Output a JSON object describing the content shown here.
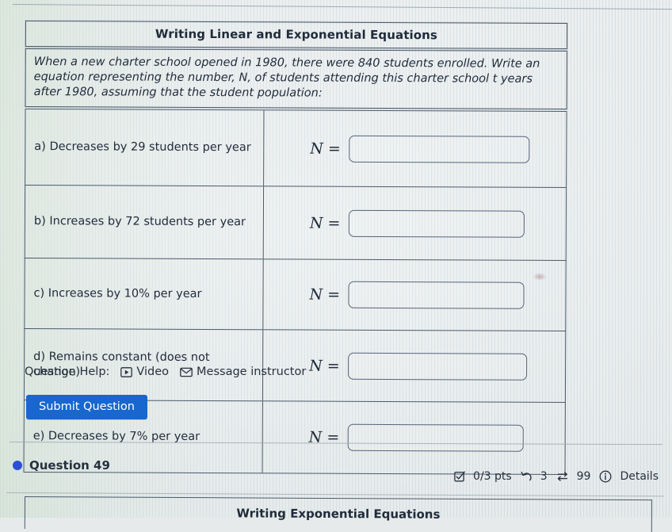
{
  "assignment": {
    "top_question": {
      "title": "Writing Linear and Exponential Equations",
      "prompt": "When a new charter school opened in 1980, there were 840 students enrolled. Write an equation representing the number, N, of students attending this charter school t years after 1980, assuming that the student population:",
      "rows": [
        {
          "label": "a) Decreases by 29 students per year",
          "lhs": "N =",
          "answer": ""
        },
        {
          "label": "b) Increases by 72 students per year",
          "lhs": "N =",
          "answer": ""
        },
        {
          "label": "c) Increases by 10% per year",
          "lhs": "N =",
          "answer": ""
        },
        {
          "label": "d) Remains constant (does not change)",
          "lhs": "N =",
          "answer": ""
        },
        {
          "label": "e) Decreases by 7% per year",
          "lhs": "N =",
          "answer": ""
        }
      ]
    },
    "help": {
      "label": "Question Help:",
      "video_label": "Video",
      "video_icon": "video-play-icon",
      "message_label": "Message instructor",
      "message_icon": "envelope-icon"
    },
    "submit_label": "Submit Question",
    "status": {
      "question_label": "Question 49",
      "points": "0/3 pts",
      "points_icon": "checkbox-check-icon",
      "attempts": "3",
      "attempts_icon": "undo-arrow-icon",
      "exchanges": "99",
      "exchanges_icon": "swap-arrows-icon",
      "details_label": "Details",
      "details_icon": "info-circle-icon"
    },
    "next_question": {
      "title": "Writing Exponential Equations"
    }
  },
  "colors": {
    "submit_button": "#1767cf",
    "question_dot": "#2a4ed4",
    "table_border": "#4b5a6a",
    "text": "#1f2b3a"
  }
}
